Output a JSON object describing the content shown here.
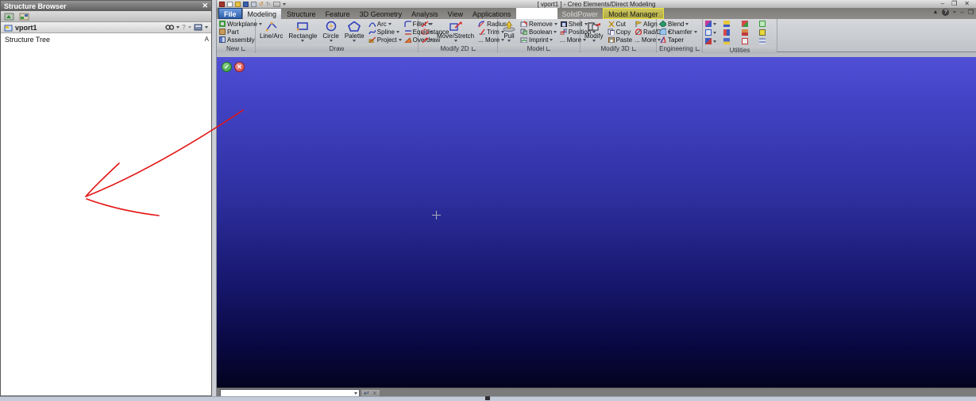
{
  "window": {
    "title": "[ vport1 ] - Creo Elements/Direct Modeling",
    "controls": {
      "minimize": "–",
      "maximize": "❒",
      "close": "✕"
    }
  },
  "quick_access": {
    "icons": [
      "app-logo",
      "new-file",
      "open-folder",
      "save-disk",
      "print-preview",
      "undo",
      "redo",
      "customize-dropdown"
    ],
    "undo_glyph": "↺",
    "redo_glyph": "↻"
  },
  "tabs": {
    "file": "File",
    "modeling": "Modeling",
    "structure": "Structure",
    "feature": "Feature",
    "geometry3d": "3D Geometry",
    "analysis": "Analysis",
    "view": "View",
    "applications": "Applications",
    "solidpower": "SolidPower",
    "model_manager": "Model Manager",
    "help_glyph": "?"
  },
  "ribbon": {
    "group_labels": [
      "New",
      "Draw",
      "Modify 2D",
      "Model",
      "Modify 3D",
      "Engineering",
      "Utilities"
    ],
    "new": {
      "workplane": "Workplane",
      "part": "Part",
      "assembly": "Assembly"
    },
    "draw": {
      "line_arc": "Line/Arc",
      "rectangle": "Rectangle",
      "circle": "Circle",
      "palette": "Palette",
      "arc": "Arc",
      "spline": "Spline",
      "project": "Project",
      "fillet": "Fillet",
      "equidistance": "Equidistance",
      "overdraw": "Overdraw"
    },
    "modify2d": {
      "move_stretch": "Move/Stretch",
      "radius": "Radius",
      "trim": "Trim",
      "more": "... More"
    },
    "model": {
      "pull": "Pull",
      "remove": "Remove",
      "boolean": "Boolean",
      "imprint": "Imprint",
      "shell": "Shell",
      "position": "Position",
      "more": "... More"
    },
    "modify3d": {
      "modify": "Modify",
      "cut": "Cut",
      "copy": "Copy",
      "paste": "Paste",
      "align": "Align",
      "rad_dia": "Rad/Dia",
      "more": "... More"
    },
    "engineering": {
      "blend": "Blend",
      "chamfer": "Chamfer",
      "taper": "Taper"
    }
  },
  "structure_browser": {
    "title": "Structure Browser",
    "close_glyph": "✕",
    "item": "vport1",
    "tree_heading": "Structure Tree",
    "corner_marker": "A"
  },
  "viewport": {
    "gradient_top": "#4f50d6",
    "gradient_bottom": "#03031f",
    "confirm_glyph": "✓",
    "cancel_glyph": "✕"
  },
  "command_bar": {
    "input_value": "",
    "enter_glyph": "↵",
    "cancel_glyph": "✕"
  },
  "annotation": {
    "type": "hand-drawn-arrow",
    "direction": "pointing down-left",
    "color": "#e31515"
  },
  "colors": {
    "file_tab_blue": "#2d5fa8",
    "model_manager_yellow": "#e9e23a",
    "ribbon_gray": "#c8ccd1",
    "bottom_strip": "#c4ccd9"
  }
}
